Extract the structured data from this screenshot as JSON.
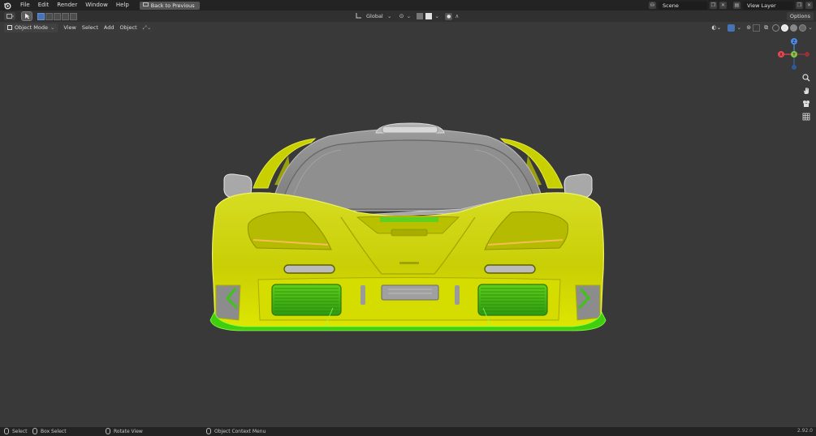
{
  "menubar": {
    "items": [
      "File",
      "Edit",
      "Render",
      "Window",
      "Help"
    ],
    "back_button": "Back to Previous",
    "scene": "Scene",
    "view_layer": "View Layer"
  },
  "toolheader": {
    "transform_orientation": "Global",
    "options": "Options"
  },
  "viewport_header": {
    "mode": "Object Mode",
    "menus": [
      "View",
      "Select",
      "Add",
      "Object"
    ]
  },
  "gizmo": {
    "x_label": "X",
    "y_label": "Y",
    "z_label": "Z",
    "colors": {
      "x": "#e8484f",
      "y": "#8bc34a",
      "z": "#4d8be8"
    }
  },
  "statusbar": {
    "select": "Select",
    "box_select": "Box Select",
    "rotate_view": "Rotate View",
    "context_menu": "Object Context Menu",
    "version": "2.92.0"
  },
  "colors": {
    "selected_yellow": "#c8d400",
    "active_green": "#47d400",
    "body_grey": "#8a8a8a",
    "background": "#393939"
  }
}
